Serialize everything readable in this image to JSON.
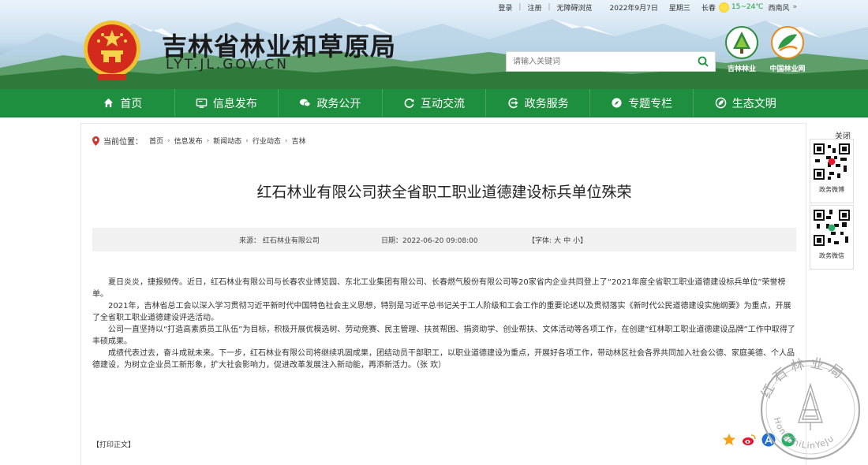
{
  "topbar": {
    "login": "登录",
    "register": "注册",
    "accessibility": "无障碍浏览",
    "date": "2022年9月7日",
    "weekday": "星期三",
    "city": "长春",
    "temp": "15~24℃",
    "wind": "西南风",
    "more": "»"
  },
  "header": {
    "title": "吉林省林业和草原局",
    "domain": "LYT.JL.GOV.CN",
    "search_placeholder": "请输入关键词",
    "logo1_caption": "吉林林业",
    "logo2_caption": "中国林业网"
  },
  "nav": [
    {
      "label": "首页",
      "icon": "home-icon"
    },
    {
      "label": "信息发布",
      "icon": "monitor-icon"
    },
    {
      "label": "政务公开",
      "icon": "chat-icon"
    },
    {
      "label": "互动交流",
      "icon": "refresh-icon"
    },
    {
      "label": "政务服务",
      "icon": "arrow-circle-icon"
    },
    {
      "label": "专题专栏",
      "icon": "compass-icon"
    },
    {
      "label": "生态文明",
      "icon": "leaf-icon"
    }
  ],
  "breadcrumb": {
    "label": "当前位置：",
    "items": [
      "首页",
      "信息发布",
      "新闻动态",
      "行业动态",
      "吉林"
    ]
  },
  "article": {
    "title": "红石林业有限公司获全省职工职业道德建设标兵单位殊荣",
    "source": "来源：  红石林业有限公司",
    "date": "日期：2022-06-20 09:08:00",
    "font_label": "【字体:",
    "font_big": "大",
    "font_mid": "中",
    "font_small": "小】",
    "paragraphs": [
      "夏日炎炎，捷报频传。近日，红石林业有限公司与长春农业博览园、东北工业集团有限公司、长春燃气股份有限公司等20家省内企业共同登上了“2021年度全省职工职业道德建设标兵单位”荣誉榜单。",
      "2021年，吉林省总工会以深入学习贯彻习近平新时代中国特色社会主义思想，特别是习近平总书记关于工人阶级和工会工作的重要论述以及贯彻落实《新时代公民道德建设实施纲要》为重点，开展了全省职工职业道德建设评选活动。",
      "公司一直坚持以“打造高素质员工队伍”为目标，积极开展优模选树、劳动竞赛、民主管理、扶贫帮困、捐资助学、创业帮扶、文体活动等各项工作，在创建“红林职工职业道德建设品牌”工作中取得了丰硕成果。",
      "成绩代表过去，奋斗成就未来。下一步，红石林业有限公司将继续巩固成果，团结动员干部职工，以职业道德建设为重点，开展好各项工作，带动林区社会各界共同加入社会公德、家庭美德、个人品德建设，为树立企业员工新形象，扩大社会影响力，促进改革发展注入新动能，再添新活力。（张 欢）"
    ],
    "print": "【打印正文】"
  },
  "stamp": {
    "top_text": "红石林业局",
    "bottom_text": "HongShiLinYeJu"
  },
  "sidebar": {
    "close": "关闭",
    "qr1_caption": "政务微博",
    "qr2_caption": "政务微信"
  },
  "colors": {
    "nav_green": "#1e8f3f",
    "title_text": "#1a1a1a",
    "temp_green": "#1f9c3a"
  }
}
